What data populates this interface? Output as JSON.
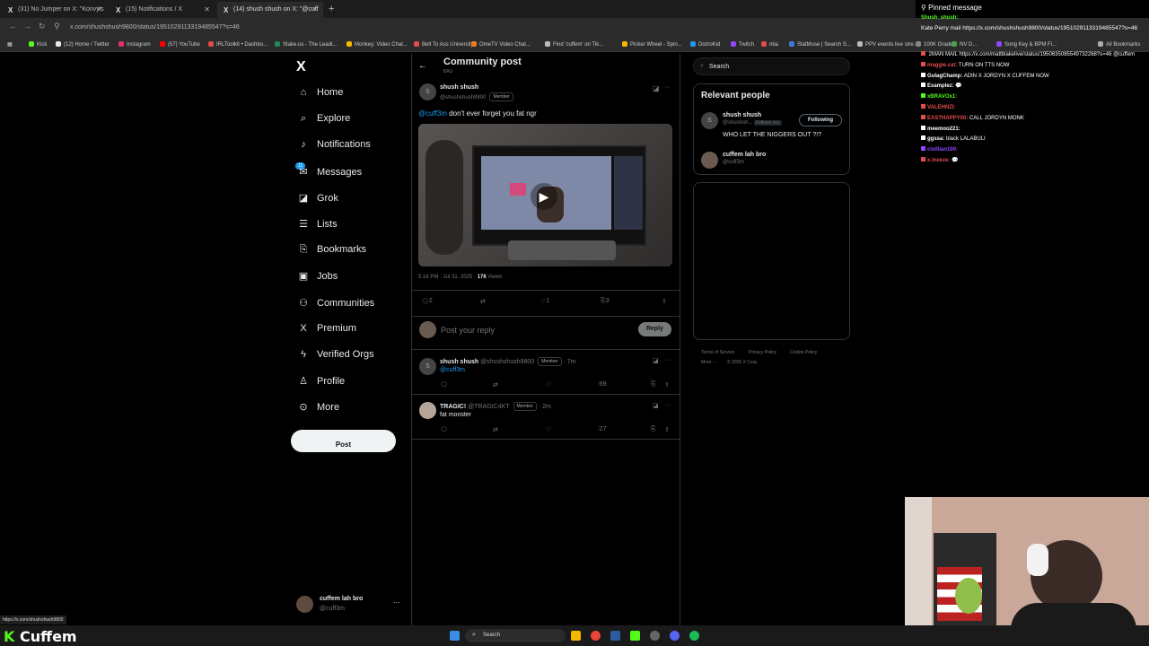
{
  "browser": {
    "tabs": [
      {
        "icon": "X",
        "title": "(31) No Jumper on X: \"Konvy's"
      },
      {
        "icon": "X",
        "title": "(15) Notifications / X"
      },
      {
        "icon": "X",
        "title": "(14) shush shush on X: \"@cuff"
      }
    ],
    "new_tab": "+",
    "url": "x.com/shushshush9800/status/1951029113319485547?s=46",
    "bookmarks": [
      "Kick",
      "(12) Home / Twitter",
      "Instagram",
      "(57) YouTube",
      "IRLToolkit • Dashbo...",
      "Stake.us - The Leadi...",
      "Monkey: Video Chat...",
      "Belt To Ass University",
      "OmeTV Video Chat...",
      "Find 'cuffem' on Tik...",
      "Picker Wheel - Spin...",
      "DistroKid",
      "Twitch",
      "nba",
      "StatMuse | Search S...",
      "PPV events live stre...",
      "100K Grade...",
      "NV D...",
      "Song Key & BPM Fi..."
    ],
    "all_bookmarks": "All Bookmarks",
    "bookmark_colors": [
      "#53fc18",
      "#e7e9ea",
      "#e1306c",
      "#ff0000",
      "#e14c4c",
      "#1f8a5a",
      "#f5b800",
      "#e14c4c",
      "#f07c1e",
      "#bbbbbb",
      "#f5b800",
      "#1d9bf0",
      "#9146ff",
      "#e14c4c",
      "#3a7bd5",
      "#bbbbbb",
      "#888888",
      "#4a9e4a",
      "#9146ff"
    ],
    "status_url": "https://x.com/shushshush9800"
  },
  "nav": {
    "logo": "X",
    "items": [
      {
        "label": "Home",
        "icon": "home-icon",
        "glyph": "⌂"
      },
      {
        "label": "Explore",
        "icon": "search-icon",
        "glyph": "⌕"
      },
      {
        "label": "Notifications",
        "icon": "bell-icon",
        "glyph": "♪"
      },
      {
        "label": "Messages",
        "icon": "mail-icon",
        "glyph": "✉",
        "badge": "11"
      },
      {
        "label": "Grok",
        "icon": "grok-icon",
        "glyph": "◪"
      },
      {
        "label": "Lists",
        "icon": "list-icon",
        "glyph": "☰"
      },
      {
        "label": "Bookmarks",
        "icon": "bookmark-icon",
        "glyph": "⎘"
      },
      {
        "label": "Jobs",
        "icon": "briefcase-icon",
        "glyph": "▣"
      },
      {
        "label": "Communities",
        "icon": "people-icon",
        "glyph": "⚇"
      },
      {
        "label": "Premium",
        "icon": "x-logo-icon",
        "glyph": "X"
      },
      {
        "label": "Verified Orgs",
        "icon": "lightning-icon",
        "glyph": "ϟ"
      },
      {
        "label": "Profile",
        "icon": "person-icon",
        "glyph": "♙"
      },
      {
        "label": "More",
        "icon": "more-circle-icon",
        "glyph": "⊙"
      }
    ],
    "post_button": "Post",
    "account": {
      "name": "cuffem lah bro",
      "handle": "@cuff3m",
      "more": "···"
    }
  },
  "center": {
    "title": "Community post",
    "subtitle": "BAU",
    "post": {
      "avatar_letter": "S",
      "name": "shush shush",
      "handle": "@shushshush9800",
      "badge": "Member",
      "mention": "@cuff3m",
      "text": " don't ever forget you fat ngr",
      "timestamp": "5:16 PM · Jul 31, 2025 · ",
      "views_count": "176",
      "views_label": " Views",
      "stats": {
        "replies": "2",
        "likes": "1",
        "bookmarks": "3"
      }
    },
    "reply_placeholder": "Post your reply",
    "reply_button": "Reply",
    "replies": [
      {
        "avatar_letter": "S",
        "name": "shush shush",
        "handle": "@shushshush9800",
        "badge": "Member",
        "time": "· 7m",
        "text": "@cuff3m",
        "views": "69"
      },
      {
        "name": "TRAGIC!",
        "handle": "@TRAGIC4KT",
        "badge": "Member",
        "time": "· 2m",
        "text": "fat monster",
        "views": "27"
      }
    ]
  },
  "right": {
    "search_placeholder": "Search",
    "relevant_title": "Relevant people",
    "people": [
      {
        "avatar_letter": "S",
        "name": "shush shush",
        "handle": "@shushsh...",
        "follows_you": "Follows you",
        "button": "Following",
        "bio": "WHO LET THE NIGGERS OUT ?!?"
      },
      {
        "name": "cuffem lah bro",
        "handle": "@cuff3m"
      }
    ],
    "footer": [
      "Terms of Service",
      "Privacy Policy",
      "Cookie Policy",
      "More ···",
      "© 2025 X Corp."
    ]
  },
  "chat": {
    "pinned_label": "Pinned message",
    "pinned_user": "Shush_shush:",
    "pinned_text": "Kate Perry mail https://x.com/shushshush9800/status/1951029113319485547?s=46",
    "messages": [
      {
        "user": "",
        "text": "2MAN MAIL https://x.com/mattblakelive/status/1950635085549732268?s=46 @cuffem",
        "color": "#e14c4c"
      },
      {
        "user": "maggie.cat:",
        "text": "TURN ON TTS NOW",
        "color": "#e14c4c"
      },
      {
        "user": "GulagChamp:",
        "text": "ADIN X JORDYN X CUFFEM NOW",
        "color": "#ffffff"
      },
      {
        "user": "Examplez:",
        "text": "💬",
        "color": "#ffffff"
      },
      {
        "user": "xBRAVOx1:",
        "text": "",
        "color": "#53fc18"
      },
      {
        "user": "VALEHNZI:",
        "text": "",
        "color": "#e14c4c"
      },
      {
        "user": "EASTHAPPY00:",
        "text": "CALL JORDYN MONK",
        "color": "#e14c4c"
      },
      {
        "user": "meemoo221:",
        "text": "",
        "color": "#ffffff"
      },
      {
        "user": "ggssa:",
        "text": "black LALABULI",
        "color": "#ffffff"
      },
      {
        "user": "civillian100:",
        "text": "",
        "color": "#9146ff"
      },
      {
        "user": "x.ineeze:",
        "text": "💬",
        "color": "#e14c4c"
      }
    ]
  },
  "taskbar": {
    "search": "Search"
  },
  "overlay": {
    "brand": "Cuffem",
    "brand_icon": "K"
  }
}
